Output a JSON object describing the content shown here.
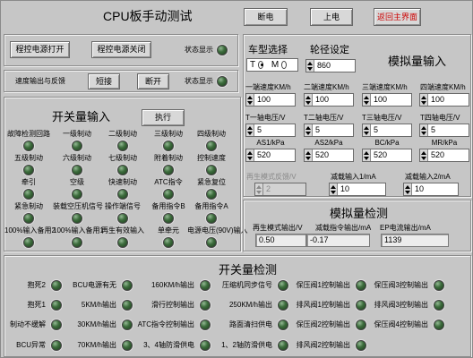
{
  "window": {
    "title": "CPU板手动测试"
  },
  "top_buttons": {
    "power_off": "断电",
    "power_on": "上电",
    "return_main": "返回主界面"
  },
  "power_control": {
    "open_button": "程控电源打开",
    "close_button": "程控电源关闭",
    "status_label": "状态显示",
    "status_on": false
  },
  "speed_control": {
    "label": "速度输出与反馈",
    "short_button": "短接",
    "open_button": "断开",
    "status_label": "状态显示",
    "status_on": false
  },
  "switch_input": {
    "title": "开关量输入",
    "execute_button": "执行",
    "items": [
      {
        "label": "故障检测回路",
        "on": false
      },
      {
        "label": "一级制动",
        "on": false
      },
      {
        "label": "二级制动",
        "on": false
      },
      {
        "label": "三级制动",
        "on": false
      },
      {
        "label": "四级制动",
        "on": false
      },
      {
        "label": "五级制动",
        "on": false
      },
      {
        "label": "六级制动",
        "on": false
      },
      {
        "label": "七级制动",
        "on": false
      },
      {
        "label": "附着制动",
        "on": false
      },
      {
        "label": "控制速度",
        "on": false
      },
      {
        "label": "牵引",
        "on": false
      },
      {
        "label": "空级",
        "on": false
      },
      {
        "label": "快速制动",
        "on": false
      },
      {
        "label": "ATC指令",
        "on": false
      },
      {
        "label": "紧急复位",
        "on": false
      },
      {
        "label": "紧急制动",
        "on": false
      },
      {
        "label": "装载空压机信号",
        "on": false
      },
      {
        "label": "操作端信号",
        "on": false
      },
      {
        "label": "备用指令B",
        "on": false
      },
      {
        "label": "备用指令A",
        "on": false
      },
      {
        "label": "100%输入备用2",
        "on": false
      },
      {
        "label": "100%输入备用1",
        "on": false
      },
      {
        "label": "再生有效输入",
        "on": false
      },
      {
        "label": "单牵元",
        "on": false
      },
      {
        "label": "电源电压(90V)输入",
        "on": false
      }
    ]
  },
  "analog_input": {
    "title": "模拟量输入",
    "vehicle_type": {
      "label": "车型选择",
      "options": [
        "T",
        "M"
      ],
      "selected_index": 0
    },
    "wheel_diameter": {
      "label": "轮径设定",
      "value": "860"
    },
    "speeds": [
      {
        "label": "一端速度KM/h",
        "value": "100"
      },
      {
        "label": "二端速度KM/h",
        "value": "100"
      },
      {
        "label": "三端速度KM/h",
        "value": "100"
      },
      {
        "label": "四端速度KM/h",
        "value": "100"
      }
    ],
    "axle_voltages": [
      {
        "label": "T一轴电压/V",
        "value": "5"
      },
      {
        "label": "T二轴电压/V",
        "value": "5"
      },
      {
        "label": "T三轴电压/V",
        "value": "5"
      },
      {
        "label": "T四轴电压/V",
        "value": "5"
      }
    ],
    "pressures": [
      {
        "label": "AS1/kPa",
        "value": "520"
      },
      {
        "label": "AS2/kPa",
        "value": "520"
      },
      {
        "label": "BC/kPa",
        "value": "520"
      },
      {
        "label": "MR/kPa",
        "value": "520"
      }
    ],
    "regen_feedback": {
      "label": "再生模式反馈/V",
      "value": "2",
      "disabled": true
    },
    "load_reduction_1": {
      "label": "减载输入1/mA",
      "value": "10"
    },
    "load_reduction_2": {
      "label": "减载输入2/mA",
      "value": "10"
    }
  },
  "analog_detect": {
    "title": "模拟量检测",
    "outputs": [
      {
        "label": "再生模式输出/V",
        "value": "0.50"
      },
      {
        "label": "减载指令输出/mA",
        "value": "-0.17"
      },
      {
        "label": "EP电流输出/mA",
        "value": "1139"
      }
    ]
  },
  "switch_detect": {
    "title": "开关量检测",
    "items": [
      {
        "label": "抱死2",
        "on": false
      },
      {
        "label": "BCU电源有无",
        "on": false
      },
      {
        "label": "160KM/h输出",
        "on": false
      },
      {
        "label": "压缩机同步信号",
        "on": false
      },
      {
        "label": "保压阀1控制输出",
        "on": false
      },
      {
        "label": "保压阀3控制输出",
        "on": false
      },
      {
        "label": "抱死1",
        "on": false
      },
      {
        "label": "5KM/h输出",
        "on": false
      },
      {
        "label": "滑行控制输出",
        "on": false
      },
      {
        "label": "250KM/h输出",
        "on": false
      },
      {
        "label": "排风阀1控制输出",
        "on": false
      },
      {
        "label": "排风阀3控制输出",
        "on": false
      },
      {
        "label": "制动不缓解",
        "on": false
      },
      {
        "label": "30KM/h输出",
        "on": false
      },
      {
        "label": "ATC指令控制输出",
        "on": false
      },
      {
        "label": "路面清扫供电",
        "on": false
      },
      {
        "label": "保压阀2控制输出",
        "on": false
      },
      {
        "label": "保压阀4控制输出",
        "on": false
      },
      {
        "label": "BCU异常",
        "on": false
      },
      {
        "label": "70KM/h输出",
        "on": false
      },
      {
        "label": "3、4轴防滑供电",
        "on": false
      },
      {
        "label": "1、2轴防滑供电",
        "on": false
      },
      {
        "label": "排风阀2控制输出",
        "on": false
      }
    ]
  },
  "colors": {
    "panel": "#c6c6c6",
    "return_button_text": "#cc0000"
  }
}
